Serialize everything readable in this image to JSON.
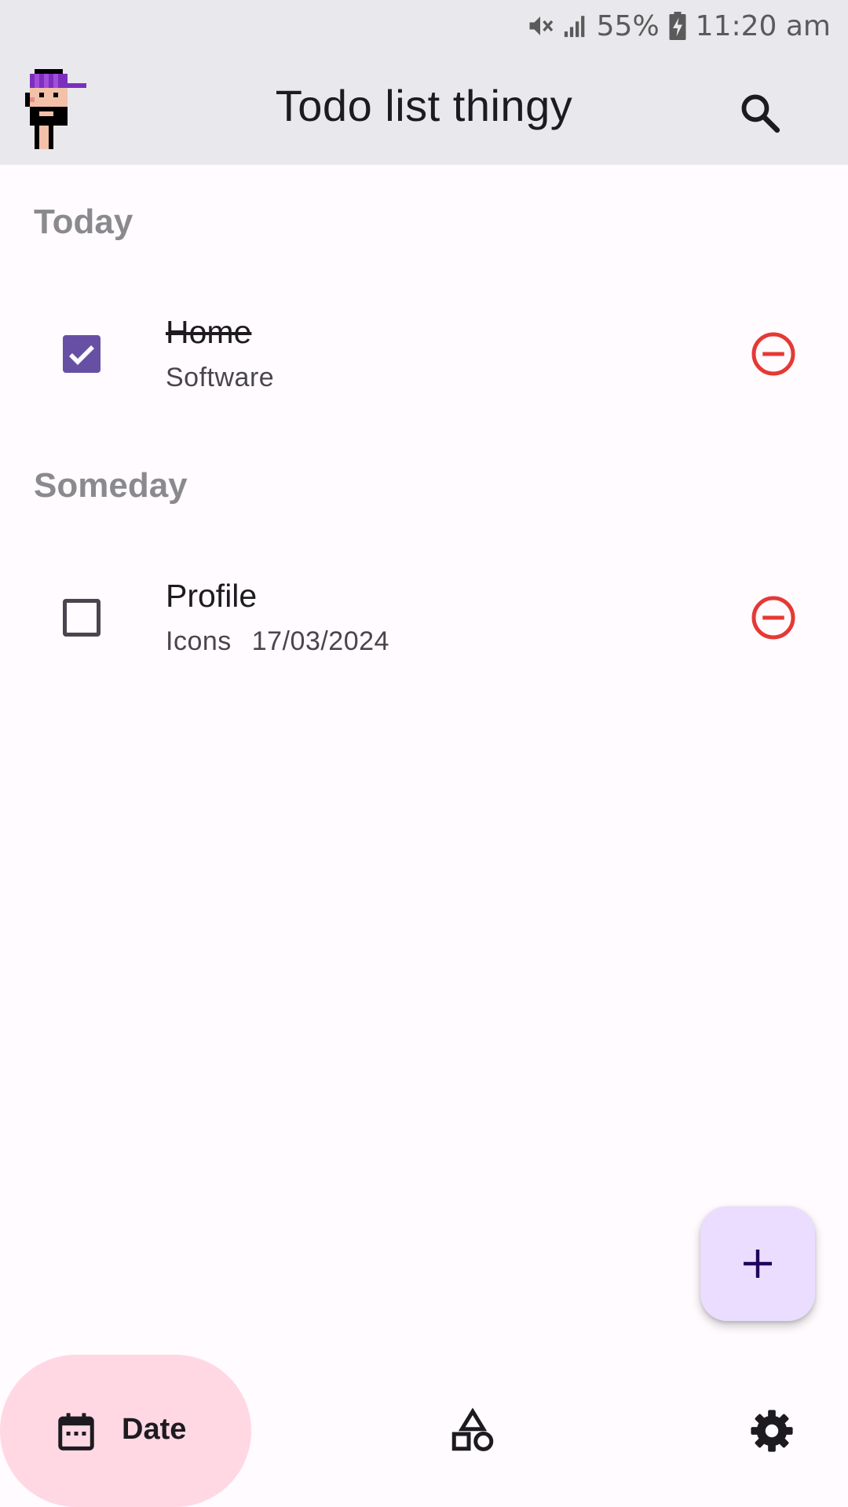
{
  "status_bar": {
    "battery": "55%",
    "time": "11:20 am",
    "icons": [
      "mute-icon",
      "signal-icon",
      "battery-charging-icon"
    ]
  },
  "app_bar": {
    "title": "Todo list thingy",
    "avatar": "pixel-avatar",
    "search_icon": "search-icon"
  },
  "sections": [
    {
      "header": "Today",
      "items": [
        {
          "title": "Home",
          "category": "Software",
          "date": "",
          "done": true
        }
      ]
    },
    {
      "header": "Someday",
      "items": [
        {
          "title": "Profile",
          "category": "Icons",
          "date": "17/03/2024",
          "done": false
        }
      ]
    }
  ],
  "fab": {
    "icon": "plus-icon"
  },
  "bottom_nav": {
    "date_label": "Date",
    "date_icon": "calendar-icon",
    "categories_icon": "shapes-icon",
    "settings_icon": "gear-icon"
  },
  "colors": {
    "bar_background": "#e9e8ec",
    "page_background": "#fffbfe",
    "checkbox_checked": "#6750a4",
    "remove_red": "#e53935",
    "fab_background": "#eaddff",
    "nav_active_background": "#ffd8e4",
    "section_header": "#8a8a8e"
  }
}
